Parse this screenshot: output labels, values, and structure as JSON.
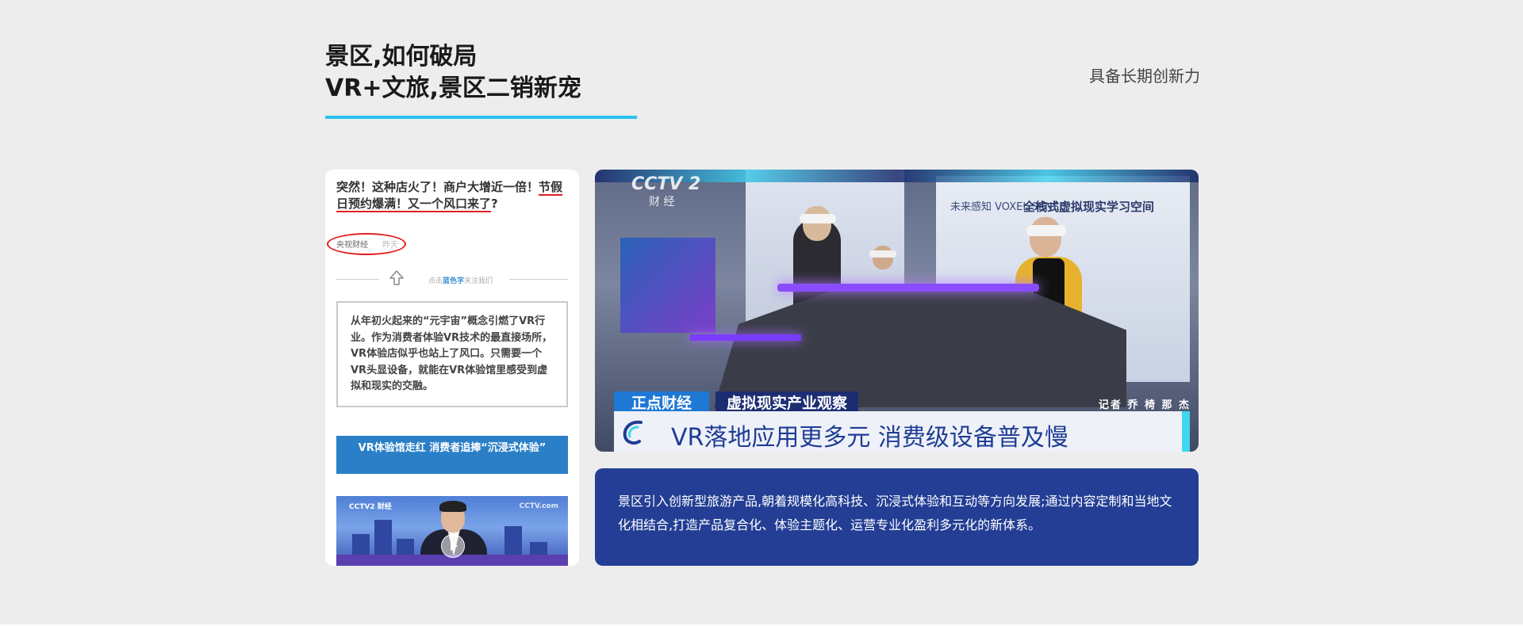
{
  "header": {
    "title_line1": "景区,如何破局",
    "title_line2": "VR+文旅,景区二销新宠",
    "tagline": "具备长期创新力",
    "accent_color": "#29c2ee"
  },
  "article": {
    "headline_plain": "突然！这种店火了！商户大增近一倍！",
    "headline_underlined": "节假日预约爆满！又一个风口来了",
    "headline_end": "?",
    "source": "央视财经",
    "time": "昨天",
    "divider_prefix": "点击",
    "divider_highlight": "蓝色字",
    "divider_suffix": "关注我们",
    "quote": "从年初火起来的“元宇宙”概念引燃了VR行业。作为消费者体验VR技术的最直接场所，VR体验店似乎也站上了风口。只需要一个VR头显设备，就能在VR体验馆里感受到虚拟和现实的交融。",
    "banner": "VR体验馆走红 消费者追捧“沉浸式体验”",
    "video_logo": "CCTV2 财经",
    "video_logo_right": "CCTV.com"
  },
  "news": {
    "channel_logo": "CCTV 2",
    "channel_name": "财 经",
    "booth_sub": "未来感知 VOXEL SENSE",
    "booth_title": "全栈式虚拟现实学习空间",
    "program": "正点财经",
    "segment": "虚拟现实产业观察",
    "reporter": "记者 乔 椅 那 杰",
    "caption": "VR落地应用更多元  消费级设备普及慢",
    "caption_color": "#1f3c96"
  },
  "description": "景区引入创新型旅游产品,朝着规模化高科技、沉浸式体验和互动等方向发展;通过内容定制和当地文化相结合,打造产品复合化、体验主题化、运营专业化盈利多元化的新体系。"
}
